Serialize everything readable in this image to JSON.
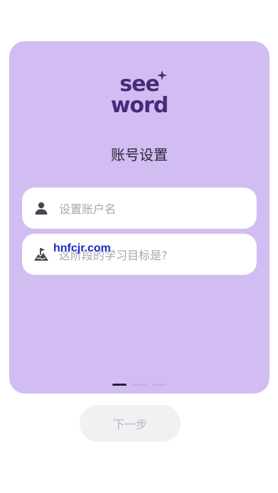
{
  "logo": {
    "line1": "see",
    "line2": "word"
  },
  "title": "账号设置",
  "fields": {
    "username": {
      "placeholder": "设置账户名",
      "icon": "user-icon"
    },
    "goal": {
      "placeholder": "这阶段的学习目标是?",
      "icon": "goal-mountain-flag-icon"
    }
  },
  "watermark": "hnfcjr.com",
  "pagination": {
    "total": 3,
    "current": 1
  },
  "next_button": {
    "label": "下一步"
  },
  "colors": {
    "card_bg": "#d2bdf2",
    "logo": "#4a2a78",
    "button_bg": "#f1f1f3",
    "button_text": "#b6b6bd"
  }
}
